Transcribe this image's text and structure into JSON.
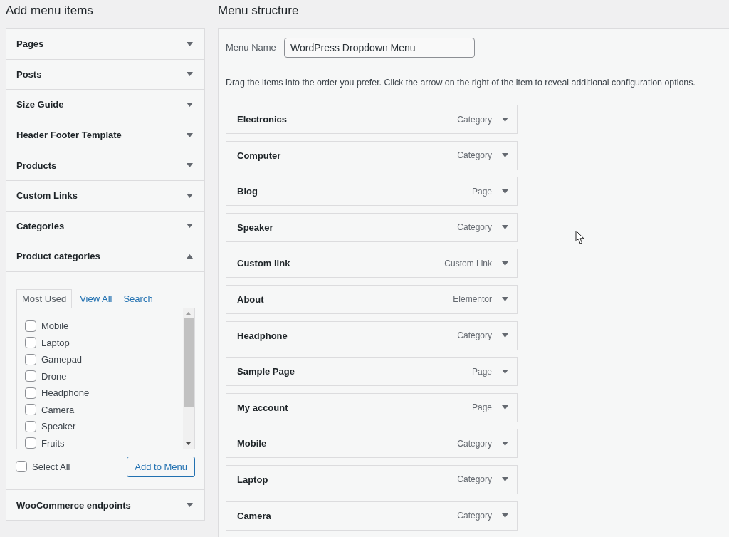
{
  "add_menu_items": {
    "title": "Add menu items",
    "sections": [
      {
        "label": "Pages",
        "expanded": false
      },
      {
        "label": "Posts",
        "expanded": false
      },
      {
        "label": "Size Guide",
        "expanded": false
      },
      {
        "label": "Header Footer Template",
        "expanded": false
      },
      {
        "label": "Products",
        "expanded": false
      },
      {
        "label": "Custom Links",
        "expanded": false
      },
      {
        "label": "Categories",
        "expanded": false
      },
      {
        "label": "Product categories",
        "expanded": true,
        "tabs": [
          {
            "label": "Most Used",
            "selected": true
          },
          {
            "label": "View All",
            "selected": false
          },
          {
            "label": "Search",
            "selected": false
          }
        ],
        "items": [
          {
            "label": "Mobile",
            "checked": false
          },
          {
            "label": "Laptop",
            "checked": false
          },
          {
            "label": "Gamepad",
            "checked": false
          },
          {
            "label": "Drone",
            "checked": false
          },
          {
            "label": "Headphone",
            "checked": false
          },
          {
            "label": "Camera",
            "checked": false
          },
          {
            "label": "Speaker",
            "checked": false
          },
          {
            "label": "Fruits",
            "checked": false
          }
        ],
        "select_all": {
          "label": "Select All",
          "checked": false
        },
        "button": "Add to Menu"
      },
      {
        "label": "WooCommerce endpoints",
        "expanded": false
      }
    ]
  },
  "menu_structure": {
    "title": "Menu structure",
    "menu_name": {
      "label": "Menu Name",
      "value": "WordPress Dropdown Menu"
    },
    "instructions": "Drag the items into the order you prefer. Click the arrow on the right of the item to reveal additional configuration options.",
    "items": [
      {
        "title": "Electronics",
        "type": "Category"
      },
      {
        "title": "Computer",
        "type": "Category"
      },
      {
        "title": "Blog",
        "type": "Page"
      },
      {
        "title": "Speaker",
        "type": "Category"
      },
      {
        "title": "Custom link",
        "type": "Custom Link"
      },
      {
        "title": "About",
        "type": "Elementor"
      },
      {
        "title": "Headphone",
        "type": "Category"
      },
      {
        "title": "Sample Page",
        "type": "Page"
      },
      {
        "title": "My account",
        "type": "Page"
      },
      {
        "title": "Mobile",
        "type": "Category"
      },
      {
        "title": "Laptop",
        "type": "Category"
      },
      {
        "title": "Camera",
        "type": "Category"
      }
    ]
  }
}
